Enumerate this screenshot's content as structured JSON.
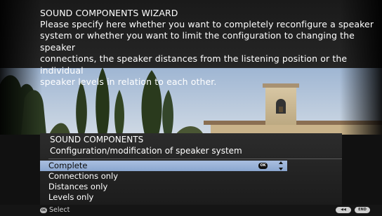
{
  "wizard": {
    "title": "SOUND COMPONENTS WIZARD",
    "lines": [
      "Please specify here whether you want to completely reconfigure a speaker",
      "system or whether you want to limit the configuration to changing the speaker",
      "connections, the speaker distances from the listening position or the individual",
      "speaker levels in relation to each other."
    ]
  },
  "panel": {
    "title": "SOUND COMPONENTS",
    "subtitle": "Configuration/modification of speaker system"
  },
  "options": [
    {
      "label": "Complete",
      "selected": true
    },
    {
      "label": "Connections only",
      "selected": false
    },
    {
      "label": "Distances only",
      "selected": false
    },
    {
      "label": "Levels only",
      "selected": false
    }
  ],
  "icons": {
    "ok": "OK",
    "back": "◀◀",
    "end": "END"
  },
  "footer": {
    "select_label": "Select"
  },
  "colors": {
    "highlight": "#9db5db",
    "panel_bg": "#2a2a2a",
    "sky": "#b8c9de"
  }
}
